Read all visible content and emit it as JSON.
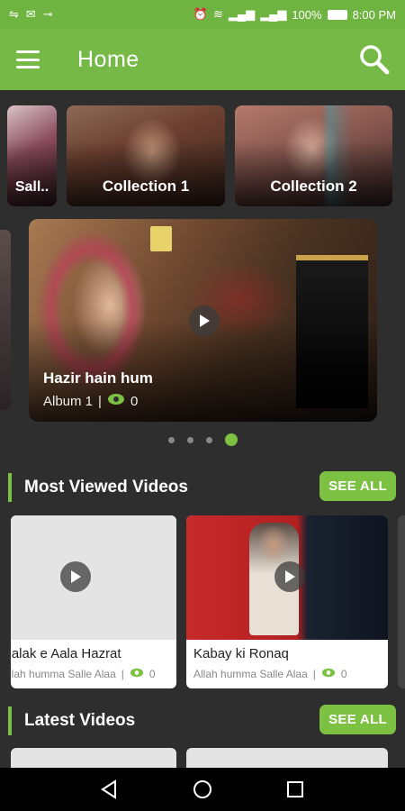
{
  "status_bar": {
    "battery": "100%",
    "time": "8:00 PM"
  },
  "app_bar": {
    "title": "Home"
  },
  "collections": [
    {
      "label": "Sall..",
      "color": "#7a3848"
    },
    {
      "label": "Collection 1",
      "color": "#5e3a2c"
    },
    {
      "label": "Collection 2",
      "color": "#6c4a44"
    }
  ],
  "hero": {
    "title": "Hazir hain hum",
    "album": "Album 1",
    "separator": "|",
    "views": "0",
    "dots": [
      false,
      false,
      false,
      true
    ]
  },
  "most_viewed": {
    "title": "Most Viewed Videos",
    "see_all": "SEE ALL",
    "videos": [
      {
        "title": "Halak e Aala Hazrat",
        "artist": "Allah humma Salle Alaa",
        "separator": "|",
        "views": "0"
      },
      {
        "title": "Kabay ki Ronaq",
        "artist": "Allah humma Salle Alaa",
        "separator": "|",
        "views": "0"
      }
    ]
  },
  "latest": {
    "title": "Latest Videos",
    "see_all": "SEE ALL"
  },
  "colors": {
    "accent": "#7cc142",
    "app_bar": "#76b947",
    "background": "#2e2e2e"
  }
}
